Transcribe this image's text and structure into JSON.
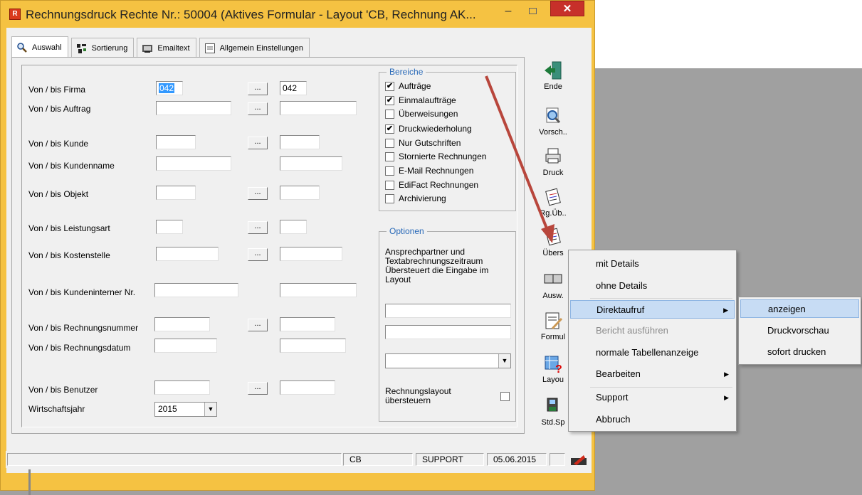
{
  "window": {
    "title": "Rechnungsdruck Rechte Nr.: 50004    (Aktives Formular - Layout 'CB, Rechnung AK...",
    "minimize": "–",
    "close": "✕"
  },
  "tabs": [
    {
      "label": "Auswahl",
      "icon": "search-icon"
    },
    {
      "label": "Sortierung",
      "icon": "sort-icon"
    },
    {
      "label": "Emailtext",
      "icon": "mail-icon"
    },
    {
      "label": "Allgemein Einstellungen",
      "icon": "settings-icon"
    }
  ],
  "fields": {
    "firma": {
      "label": "Von / bis Firma",
      "from": "042",
      "to": "042"
    },
    "auftrag": {
      "label": "Von / bis Auftrag",
      "from": "",
      "to": ""
    },
    "kunde": {
      "label": "Von / bis Kunde",
      "from": "",
      "to": ""
    },
    "kundenname": {
      "label": "Von / bis Kundenname",
      "from": "",
      "to": ""
    },
    "objekt": {
      "label": "Von / bis Objekt",
      "from": "",
      "to": ""
    },
    "leistungsart": {
      "label": "Von / bis Leistungsart",
      "from": "",
      "to": ""
    },
    "kostenstelle": {
      "label": "Von / bis Kostenstelle",
      "from": "",
      "to": ""
    },
    "kundeninterne": {
      "label": "Von / bis Kundeninterner Nr.",
      "from": "",
      "to": ""
    },
    "rechnungsnummer": {
      "label": "Von / bis Rechnungsnummer",
      "from": "",
      "to": ""
    },
    "rechnungsdatum": {
      "label": "Von / bis Rechnungsdatum",
      "from": "",
      "to": ""
    },
    "benutzer": {
      "label": "Von / bis Benutzer",
      "from": "",
      "to": ""
    },
    "wirtschaftsjahr": {
      "label": "Wirtschaftsjahr",
      "value": "2015"
    }
  },
  "dots_label": "...",
  "bereiche": {
    "title": "Bereiche",
    "items": [
      {
        "label": "Aufträge",
        "checked": "✔"
      },
      {
        "label": "Einmalaufträge",
        "checked": "✔"
      },
      {
        "label": "Überweisungen",
        "checked": ""
      },
      {
        "label": "Druckwiederholung",
        "checked": "✔"
      },
      {
        "label": "Nur Gutschriften",
        "checked": ""
      },
      {
        "label": "Stornierte Rechnungen",
        "checked": ""
      },
      {
        "label": "E-Mail Rechnungen",
        "checked": ""
      },
      {
        "label": "EdiFact Rechnungen",
        "checked": ""
      },
      {
        "label": "Archivierung",
        "checked": ""
      }
    ]
  },
  "optionen": {
    "title": "Optionen",
    "text1": "Ansprechpartner und",
    "text2": "Textabrechnungszeitraum",
    "text3": "Übersteuert die Eingabe im",
    "text4": "Layout",
    "layout_override1": "Rechnungslayout",
    "layout_override2": "übersteuern"
  },
  "toolbar": [
    {
      "label": "Ende",
      "icon": "exit-door-icon"
    },
    {
      "label": "Vorsch..",
      "icon": "preview-icon"
    },
    {
      "label": "Druck",
      "icon": "printer-icon"
    },
    {
      "label": "Rg.Üb..",
      "icon": "invoice-overview-icon"
    },
    {
      "label": "Übers",
      "icon": "overview-icon"
    },
    {
      "label": "Ausw.",
      "icon": "evaluation-icon"
    },
    {
      "label": "Formul",
      "icon": "form-icon"
    },
    {
      "label": "Layou",
      "icon": "layout-icon"
    },
    {
      "label": "Std.Sp",
      "icon": "save-default-icon"
    }
  ],
  "context_menu": {
    "items": [
      "mit Details",
      "ohne Details",
      "Direktaufruf",
      "Bericht ausführen",
      "normale Tabellenanzeige",
      "Bearbeiten",
      "Support",
      "Abbruch"
    ]
  },
  "submenu": {
    "items": [
      "anzeigen",
      "Druckvorschau",
      "sofort drucken"
    ]
  },
  "statusbar": {
    "firm": "CB",
    "user": "SUPPORT",
    "date": "05.06.2015"
  },
  "colors": {
    "accent": "#3399ff",
    "group_title": "#2a6ab8",
    "title_bar": "#f5c242",
    "close_button": "#c7302a",
    "arrow": "#b8463c"
  }
}
